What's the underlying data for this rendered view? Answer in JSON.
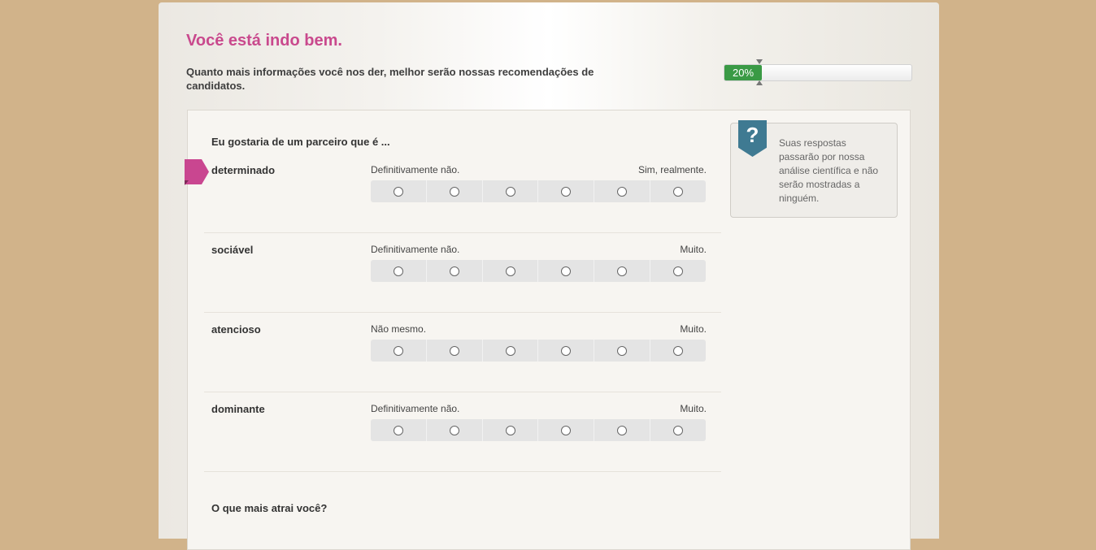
{
  "header": {
    "headline": "Você está indo bem.",
    "subtext": "Quanto mais informações você nos der, melhor serão nossas recomendações de candidatos."
  },
  "progress": {
    "label": "20%",
    "value": 0.2,
    "fill_color": "#3a9a45"
  },
  "colors": {
    "accent": "#c9498d",
    "page_background": "#d1b38a",
    "help_badge": "#3f7a92"
  },
  "question": {
    "title": "Eu gostaria de um parceiro que é ...",
    "rows": [
      {
        "trait": "determinado",
        "left_label": "Definitivamente não.",
        "right_label": "Sim, realmente."
      },
      {
        "trait": "sociável",
        "left_label": "Definitivamente não.",
        "right_label": "Muito."
      },
      {
        "trait": "atencioso",
        "left_label": "Não mesmo.",
        "right_label": "Muito."
      },
      {
        "trait": "dominante",
        "left_label": "Definitivamente não.",
        "right_label": "Muito."
      }
    ],
    "scale_points": 6
  },
  "help": {
    "icon": "question-icon",
    "badge_glyph": "?",
    "text": "Suas respostas passarão por nossa análise científica e não serão mostradas a ninguém."
  },
  "next_question": "O que mais atrai você?"
}
